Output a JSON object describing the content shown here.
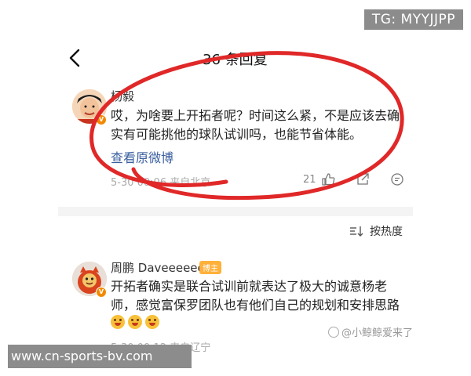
{
  "overlay": {
    "tg_badge": "TG: MYYJJPP",
    "site_url": "www.cn-sports-bv.com",
    "watermark": "@小鲸鲸爱来了"
  },
  "header": {
    "title": "36 条回复"
  },
  "comment1": {
    "author": "杨毅",
    "text": "哎，为啥要上开拓者呢？时间这么紧，不是应该去确实有可能挑他的球队试训吗，也能节省体能。",
    "link": "查看原微博",
    "meta": "5-30 00:06  来自北京",
    "like_count": "21"
  },
  "sort": {
    "label": "按热度"
  },
  "comment2": {
    "author": "周鹏 Daveeeeee",
    "badge": "博主",
    "text": "开拓者确实是联合试训前就表达了极大的诚意杨老师，感觉富保罗团队也有他们自己的规划和安排思路",
    "meta": "5-30 00:12  来自辽宁"
  },
  "colors": {
    "highlight": "#e02828",
    "link": "#3a5f9e",
    "badge": "#ffb13b",
    "vip": "#f28a00"
  }
}
